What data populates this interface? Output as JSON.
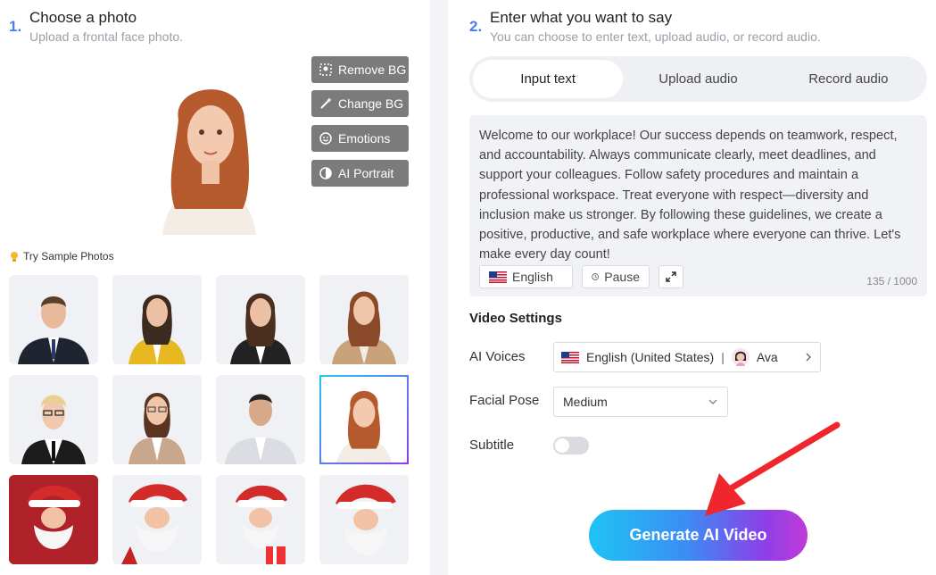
{
  "left": {
    "step_num": "1.",
    "title": "Choose a photo",
    "subtitle": "Upload a frontal face photo.",
    "buttons": {
      "remove_bg": "Remove BG",
      "change_bg": "Change BG",
      "emotions": "Emotions",
      "ai_portrait": "AI Portrait"
    },
    "sample_label": "Try Sample Photos"
  },
  "right": {
    "step_num": "2.",
    "title": "Enter what you want to say",
    "subtitle": "You can choose to enter text, upload audio, or record audio.",
    "tabs": [
      "Input text",
      "Upload audio",
      "Record audio"
    ],
    "text": "Welcome to our workplace! Our success depends on teamwork, respect, and accountability. Always communicate clearly, meet deadlines, and support your colleagues. Follow safety procedures and maintain a professional workspace. Treat everyone with respect—diversity and inclusion make us stronger. By following these guidelines, we create a positive, productive, and safe workplace where everyone can thrive. Let's make every day count!",
    "language": "English",
    "pause": "Pause",
    "char_count": "135 / 1000",
    "video_settings": "Video Settings",
    "ai_voices_label": "AI Voices",
    "voice_language": "English (United States)",
    "voice_name": "Ava",
    "facial_pose_label": "Facial Pose",
    "facial_pose_value": "Medium",
    "subtitle_label": "Subtitle",
    "subtitle_on": false,
    "generate": "Generate AI Video"
  },
  "colors": {
    "accent": "#4a7df5",
    "button_gray": "#7b7b7b",
    "arrow_red": "#f0262d"
  }
}
